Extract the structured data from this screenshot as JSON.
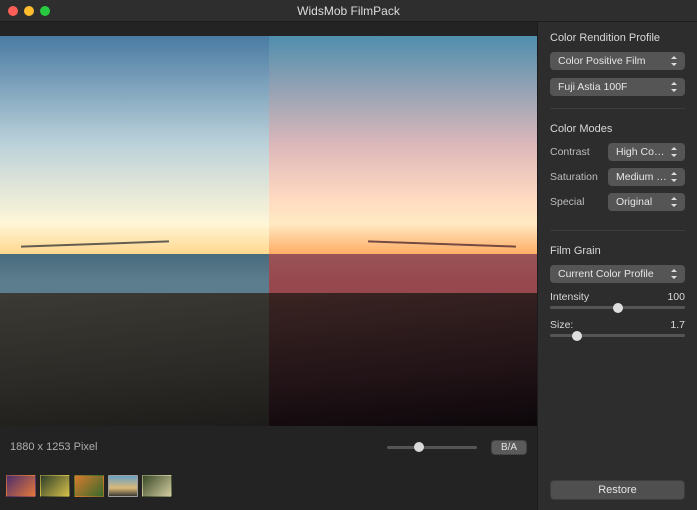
{
  "app": {
    "title": "WidsMob FilmPack"
  },
  "preview": {
    "dimensions_label": "1880 x 1253 Pixel",
    "ba_button_label": "B/A",
    "zoom_percent": 35,
    "compare_mode": "before-after"
  },
  "thumbnails": {
    "selected_index": 3,
    "items": [
      {
        "name": "thumb-1"
      },
      {
        "name": "thumb-2"
      },
      {
        "name": "thumb-3"
      },
      {
        "name": "thumb-4"
      },
      {
        "name": "thumb-5"
      }
    ]
  },
  "panel": {
    "color_rendition": {
      "title": "Color Rendition Profile",
      "type_value": "Color Positive Film",
      "film_value": "Fuji Astia 100F"
    },
    "color_modes": {
      "title": "Color Modes",
      "contrast_label": "Contrast",
      "contrast_value": "High Contrast",
      "saturation_label": "Saturation",
      "saturation_value": "Medium Hig...",
      "special_label": "Special",
      "special_value": "Original"
    },
    "film_grain": {
      "title": "Film Grain",
      "profile_value": "Current Color Profile",
      "intensity_label": "Intensity",
      "intensity_value": "100",
      "intensity_percent": 50,
      "size_label": "Size:",
      "size_value": "1.7",
      "size_percent": 20
    },
    "restore_label": "Restore"
  }
}
